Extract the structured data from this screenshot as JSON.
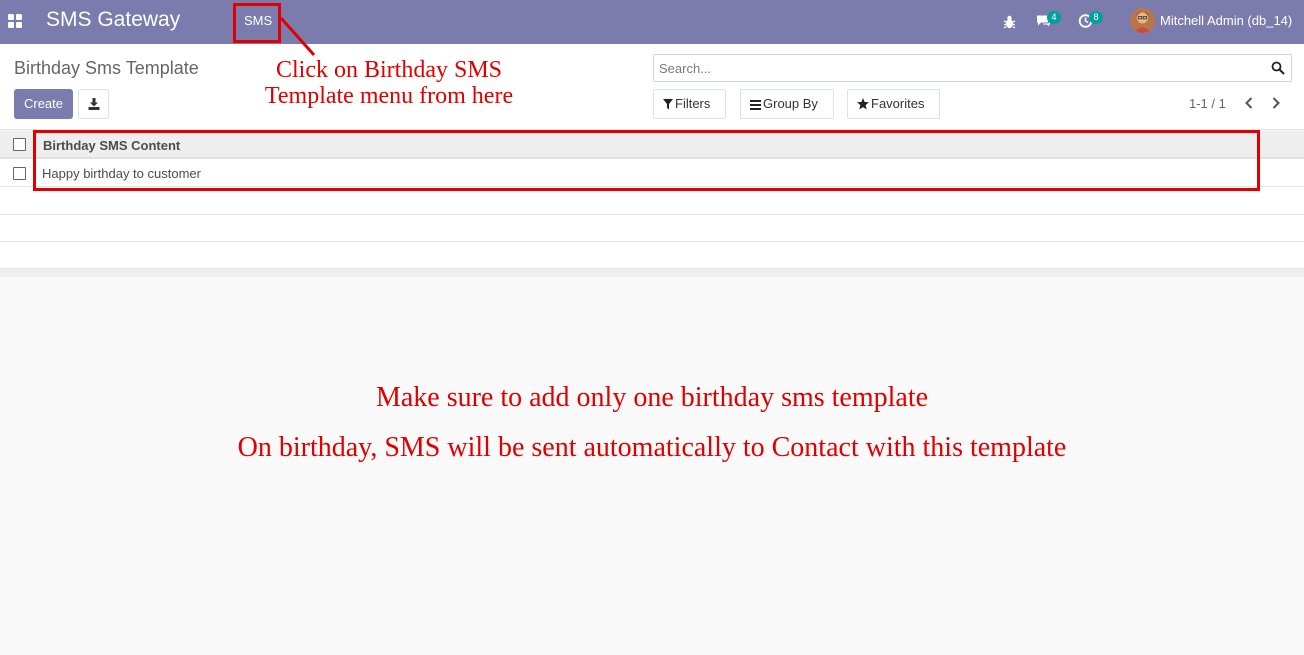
{
  "navbar": {
    "app_name": "SMS Gateway",
    "menu_item": "SMS",
    "chat_count": "4",
    "activity_count": "8",
    "user_name": "Mitchell Admin (db_14)",
    "icons": [
      "apps-icon",
      "bug-icon",
      "chat-icon",
      "clock-icon",
      "avatar"
    ]
  },
  "control_panel": {
    "title": "Birthday Sms Template",
    "create_label": "Create",
    "search_placeholder": "Search...",
    "filters_label": "Filters",
    "group_by_label": "Group By",
    "favorites_label": "Favorites",
    "pager": "1-1 / 1"
  },
  "list": {
    "column": "Birthday SMS Content",
    "rows": [
      "Happy birthday to customer"
    ]
  },
  "annotations": {
    "menu_hint": "Click on Birthday SMS Template menu from here",
    "note_1": "Make sure to add only one birthday sms template",
    "note_2": "On birthday, SMS will be sent automatically to Contact with this template"
  },
  "colors": {
    "navbar": "#7c7bad",
    "primary_button": "#7c7bad",
    "badge": "#00a09d",
    "annotation": "#e00000"
  }
}
